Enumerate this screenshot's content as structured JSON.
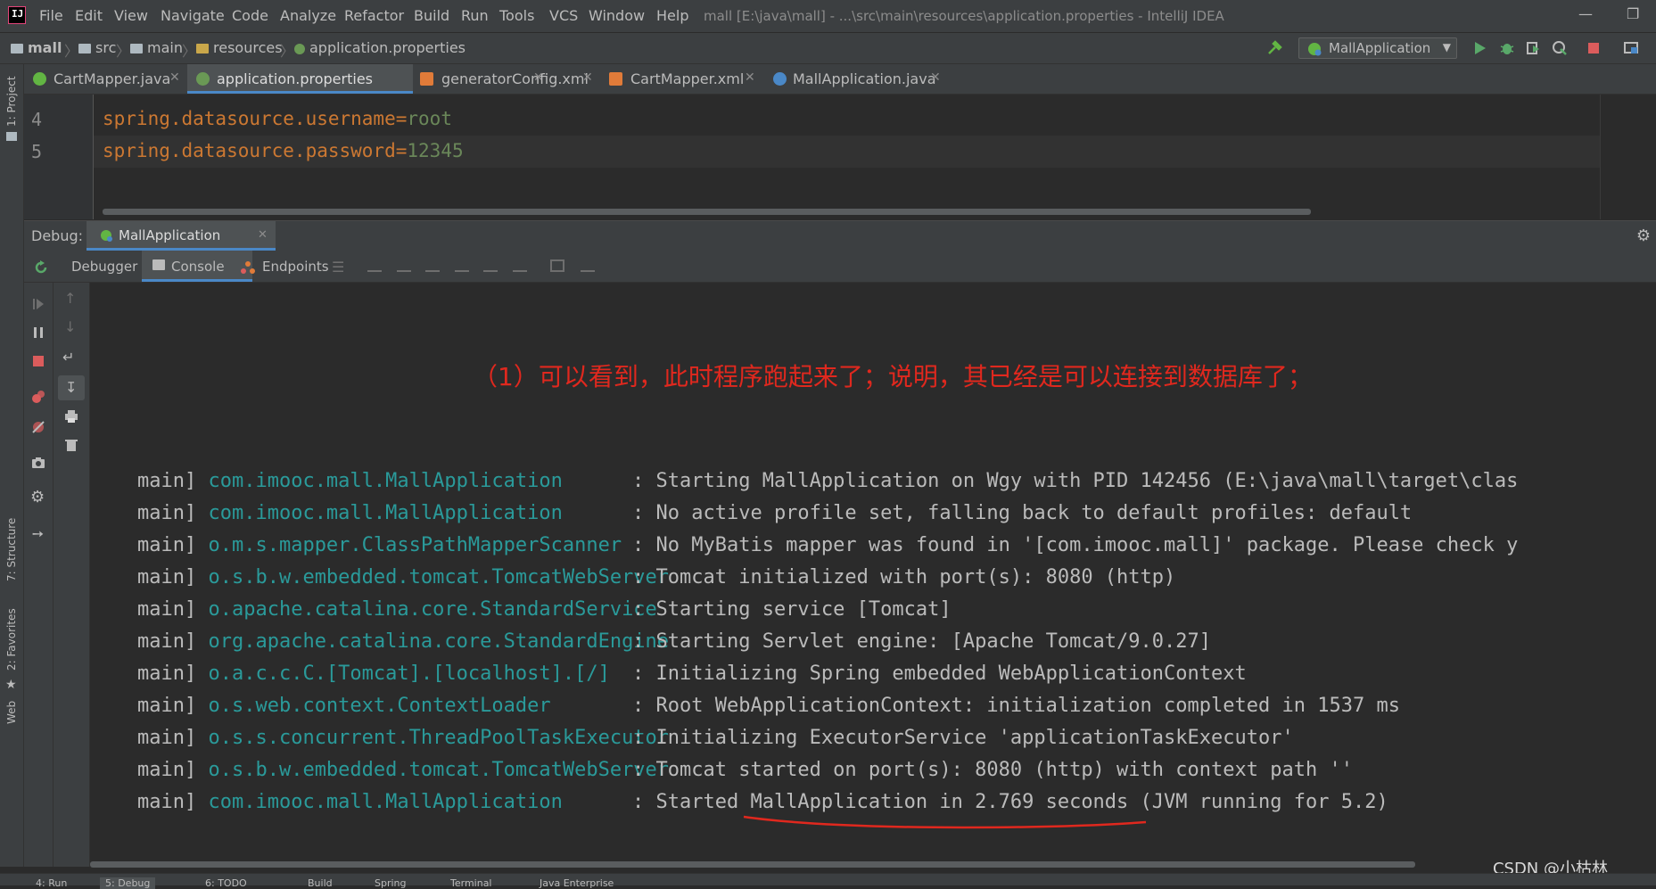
{
  "menu": {
    "items": [
      "File",
      "Edit",
      "View",
      "Navigate",
      "Code",
      "Analyze",
      "Refactor",
      "Build",
      "Run",
      "Tools",
      "VCS",
      "Window",
      "Help"
    ],
    "window_title": "mall [E:\\java\\mall] - ...\\src\\main\\resources\\application.properties - IntelliJ IDEA"
  },
  "breadcrumb": [
    "mall",
    "src",
    "main",
    "resources",
    "application.properties"
  ],
  "run_config": "MallApplication",
  "left_strip": {
    "project": "1: Project",
    "structure": "7: Structure",
    "favorites": "2: Favorites",
    "web": "Web"
  },
  "editor_tabs": [
    {
      "label": "CartMapper.java",
      "active": false,
      "icon_color": "#62b543"
    },
    {
      "label": "application.properties",
      "active": true,
      "icon_color": "#6a9955"
    },
    {
      "label": "generatorConfig.xml",
      "active": false,
      "icon_color": "#e07b39"
    },
    {
      "label": "CartMapper.xml",
      "active": false,
      "icon_color": "#e07b39"
    },
    {
      "label": "MallApplication.java",
      "active": false,
      "icon_color": "#4a88c7"
    }
  ],
  "editor": {
    "lines": [
      {
        "num": "4",
        "key": "spring.datasource.username",
        "eq": "=",
        "value": "root"
      },
      {
        "num": "5",
        "key": "spring.datasource.password",
        "eq": "=",
        "value": "12345"
      }
    ]
  },
  "debug": {
    "label": "Debug:",
    "session_tab": "MallApplication",
    "tabs": [
      "Debugger",
      "Console",
      "Endpoints"
    ]
  },
  "console": {
    "annotation": "（1）可以看到，此时程序跑起来了；说明，其已经是可以连接到数据库了；",
    "log_lines": [
      {
        "thread": "main]",
        "logger": "com.imooc.mall.MallApplication",
        "message": ": Starting MallApplication on Wgy with PID 142456 (E:\\java\\mall\\target\\clas"
      },
      {
        "thread": "main]",
        "logger": "com.imooc.mall.MallApplication",
        "message": ": No active profile set, falling back to default profiles: default"
      },
      {
        "thread": "main]",
        "logger": "o.m.s.mapper.ClassPathMapperScanner",
        "message": ": No MyBatis mapper was found in '[com.imooc.mall]' package. Please check y"
      },
      {
        "thread": "main]",
        "logger": "o.s.b.w.embedded.tomcat.TomcatWebServer",
        "message": ": Tomcat initialized with port(s): 8080 (http)"
      },
      {
        "thread": "main]",
        "logger": "o.apache.catalina.core.StandardService",
        "message": ": Starting service [Tomcat]"
      },
      {
        "thread": "main]",
        "logger": "org.apache.catalina.core.StandardEngine",
        "message": ": Starting Servlet engine: [Apache Tomcat/9.0.27]"
      },
      {
        "thread": "main]",
        "logger": "o.a.c.c.C.[Tomcat].[localhost].[/]",
        "message": ": Initializing Spring embedded WebApplicationContext"
      },
      {
        "thread": "main]",
        "logger": "o.s.web.context.ContextLoader",
        "message": ": Root WebApplicationContext: initialization completed in 1537 ms"
      },
      {
        "thread": "main]",
        "logger": "o.s.s.concurrent.ThreadPoolTaskExecutor",
        "message": ": Initializing ExecutorService 'applicationTaskExecutor'"
      },
      {
        "thread": "main]",
        "logger": "o.s.b.w.embedded.tomcat.TomcatWebServer",
        "message": ": Tomcat started on port(s): 8080 (http) with context path ''"
      },
      {
        "thread": "main]",
        "logger": "com.imooc.mall.MallApplication",
        "message": ": Started MallApplication in 2.769 seconds (JVM running for 5.2)"
      }
    ]
  },
  "status_bar": [
    "4: Run",
    "5: Debug",
    "6: TODO",
    "Build",
    "Spring",
    "Terminal",
    "Java Enterprise"
  ],
  "watermark": "CSDN @小枯林",
  "colors": {
    "accent": "#4a88c7",
    "annotation": "#e0281e",
    "logger": "#2a9a9a",
    "key": "#cc7832",
    "value": "#6a8759"
  }
}
